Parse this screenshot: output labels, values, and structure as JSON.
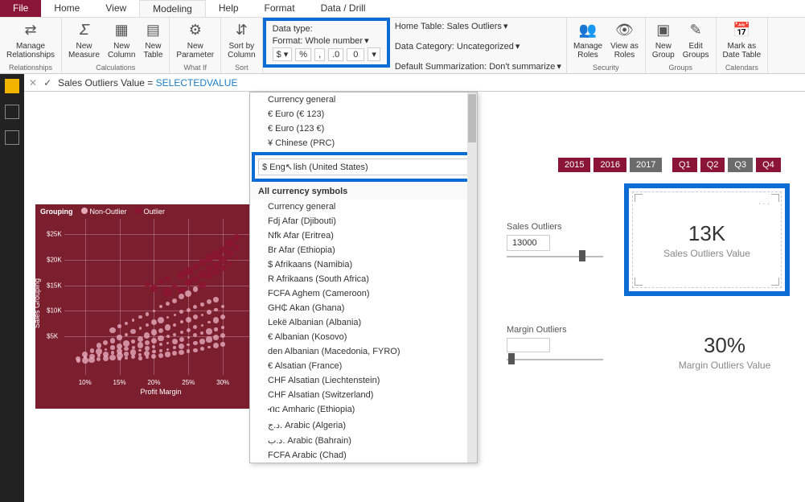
{
  "tabs": {
    "file": "File",
    "home": "Home",
    "view": "View",
    "modeling": "Modeling",
    "help": "Help",
    "format": "Format",
    "data_drill": "Data / Drill"
  },
  "ribbon": {
    "relationships": {
      "item": "Manage\nRelationships",
      "label": "Relationships"
    },
    "calculations": {
      "new_measure": "New\nMeasure",
      "new_column": "New\nColumn",
      "new_table": "New\nTable",
      "new_parameter": "New\nParameter",
      "label": "Calculations"
    },
    "whatif": {
      "label": "What If"
    },
    "sort": {
      "sort_by_column": "Sort by\nColumn",
      "label": "Sort"
    },
    "formatting": {
      "data_type_label": "Data type:",
      "format_label": "Format: Whole number",
      "dollar": "$",
      "pct": "%",
      "comma": ",",
      "dec_label": "0",
      "dec_value": "0"
    },
    "properties": {
      "home_table": "Home Table: Sales Outliers",
      "caret": "▾",
      "data_category": "Data Category: Uncategorized",
      "caret2": "▾",
      "default_summ": "Default Summarization: Don't summarize",
      "caret3": "▾"
    },
    "security": {
      "manage_roles": "Manage\nRoles",
      "view_as": "View as\nRoles",
      "label": "Security"
    },
    "groups": {
      "new_group": "New\nGroup",
      "edit_groups": "Edit\nGroups",
      "label": "Groups"
    },
    "calendars": {
      "mark_date": "Mark as\nDate Table",
      "label": "Calendars"
    }
  },
  "formula": {
    "x": "✕",
    "check": "✓",
    "text_pre": "Sales Outliers Value = ",
    "fn": "SELECTEDVALUE"
  },
  "chart_data": {
    "type": "scatter",
    "title": "",
    "xlabel": "Profit Margin",
    "ylabel": "Sales Grouping",
    "legend": {
      "grouping": "Grouping",
      "non_outlier": "Non-Outlier",
      "outlier": "Outlier"
    },
    "x_ticks": [
      "10%",
      "15%",
      "20%",
      "25%",
      "30%"
    ],
    "y_ticks": [
      "$5K",
      "$10K",
      "$15K",
      "$20K",
      "$25K"
    ],
    "xlim": [
      7,
      35
    ],
    "ylim": [
      0,
      28000
    ],
    "series": [
      {
        "name": "Non-Outlier",
        "points": [
          [
            9,
            200
          ],
          [
            9,
            600
          ],
          [
            10,
            300
          ],
          [
            10,
            900
          ],
          [
            10,
            1500
          ],
          [
            11,
            400
          ],
          [
            11,
            1100
          ],
          [
            11,
            2200
          ],
          [
            12,
            500
          ],
          [
            12,
            1300
          ],
          [
            12,
            2000
          ],
          [
            12,
            3200
          ],
          [
            13,
            700
          ],
          [
            13,
            1500
          ],
          [
            13,
            2400
          ],
          [
            13,
            3800
          ],
          [
            14,
            900
          ],
          [
            14,
            1800
          ],
          [
            14,
            2800
          ],
          [
            14,
            4200
          ],
          [
            15,
            600
          ],
          [
            15,
            1200
          ],
          [
            15,
            2100
          ],
          [
            15,
            3100
          ],
          [
            15,
            4800
          ],
          [
            16,
            800
          ],
          [
            16,
            1600
          ],
          [
            16,
            2600
          ],
          [
            16,
            3600
          ],
          [
            16,
            5400
          ],
          [
            17,
            1000
          ],
          [
            17,
            1900
          ],
          [
            17,
            2900
          ],
          [
            17,
            4000
          ],
          [
            17,
            6000
          ],
          [
            18,
            700
          ],
          [
            18,
            1400
          ],
          [
            18,
            2300
          ],
          [
            18,
            3300
          ],
          [
            18,
            4500
          ],
          [
            18,
            6600
          ],
          [
            19,
            900
          ],
          [
            19,
            1700
          ],
          [
            19,
            2700
          ],
          [
            19,
            3800
          ],
          [
            19,
            5200
          ],
          [
            19,
            7200
          ],
          [
            20,
            1100
          ],
          [
            20,
            2000
          ],
          [
            20,
            3000
          ],
          [
            20,
            4200
          ],
          [
            20,
            5800
          ],
          [
            20,
            7800
          ],
          [
            21,
            1300
          ],
          [
            21,
            2200
          ],
          [
            21,
            3400
          ],
          [
            21,
            4600
          ],
          [
            21,
            6200
          ],
          [
            21,
            8200
          ],
          [
            22,
            1500
          ],
          [
            22,
            2500
          ],
          [
            22,
            3700
          ],
          [
            22,
            5000
          ],
          [
            22,
            6800
          ],
          [
            22,
            8800
          ],
          [
            23,
            1700
          ],
          [
            23,
            2800
          ],
          [
            23,
            4000
          ],
          [
            23,
            5400
          ],
          [
            23,
            7200
          ],
          [
            23,
            9200
          ],
          [
            24,
            1900
          ],
          [
            24,
            3100
          ],
          [
            24,
            4400
          ],
          [
            24,
            5800
          ],
          [
            24,
            7800
          ],
          [
            24,
            9800
          ],
          [
            25,
            2100
          ],
          [
            25,
            3400
          ],
          [
            25,
            4800
          ],
          [
            25,
            6200
          ],
          [
            25,
            8200
          ],
          [
            25,
            10200
          ],
          [
            26,
            2300
          ],
          [
            26,
            3700
          ],
          [
            26,
            5200
          ],
          [
            26,
            6800
          ],
          [
            26,
            8800
          ],
          [
            26,
            10800
          ],
          [
            27,
            2600
          ],
          [
            27,
            4000
          ],
          [
            27,
            5600
          ],
          [
            27,
            7200
          ],
          [
            27,
            9200
          ],
          [
            27,
            11200
          ],
          [
            28,
            2900
          ],
          [
            28,
            4400
          ],
          [
            28,
            6000
          ],
          [
            28,
            7800
          ],
          [
            28,
            9800
          ],
          [
            28,
            11800
          ],
          [
            29,
            3200
          ],
          [
            29,
            4800
          ],
          [
            29,
            6400
          ],
          [
            29,
            8200
          ],
          [
            29,
            10200
          ],
          [
            29,
            12200
          ],
          [
            30,
            3500
          ],
          [
            30,
            5200
          ],
          [
            30,
            6800
          ],
          [
            30,
            8800
          ],
          [
            30,
            10800
          ],
          [
            14,
            6200
          ],
          [
            15,
            7000
          ],
          [
            16,
            7600
          ],
          [
            17,
            8200
          ],
          [
            18,
            8800
          ],
          [
            19,
            9400
          ],
          [
            20,
            10000
          ],
          [
            21,
            10800
          ],
          [
            22,
            11400
          ],
          [
            23,
            12000
          ],
          [
            24,
            12800
          ],
          [
            25,
            13400
          ],
          [
            26,
            14200
          ]
        ]
      },
      {
        "name": "Outlier",
        "points": [
          [
            19,
            15200
          ],
          [
            20,
            14400
          ],
          [
            21,
            15800
          ],
          [
            22,
            13600
          ],
          [
            22,
            16400
          ],
          [
            23,
            14800
          ],
          [
            24,
            17000
          ],
          [
            24,
            14000
          ],
          [
            25,
            15600
          ],
          [
            25,
            17800
          ],
          [
            26,
            16200
          ],
          [
            26,
            18600
          ],
          [
            27,
            15000
          ],
          [
            27,
            17200
          ],
          [
            27,
            19400
          ],
          [
            28,
            16800
          ],
          [
            28,
            18200
          ],
          [
            28,
            20200
          ],
          [
            29,
            17600
          ],
          [
            29,
            19000
          ],
          [
            29,
            21000
          ],
          [
            30,
            18400
          ],
          [
            30,
            20000
          ],
          [
            30,
            22000
          ],
          [
            31,
            19200
          ],
          [
            31,
            21200
          ],
          [
            31,
            23200
          ],
          [
            32,
            20400
          ],
          [
            32,
            22400
          ],
          [
            32,
            24400
          ]
        ]
      }
    ]
  },
  "dropdown": {
    "top": [
      "Currency general",
      "€ Euro (€ 123)",
      "€ Euro (123 €)",
      "¥ Chinese (PRC)"
    ],
    "search_value": "$ English (United States)",
    "header": "All currency symbols",
    "items": [
      "Currency general",
      "Fdj Afar (Djibouti)",
      "Nfk Afar (Eritrea)",
      "Br Afar (Ethiopia)",
      "$ Afrikaans (Namibia)",
      "R Afrikaans (South Africa)",
      "FCFA Aghem (Cameroon)",
      "GH₵ Akan (Ghana)",
      "Lekë Albanian (Albania)",
      "€ Albanian (Kosovo)",
      "den Albanian (Macedonia, FYRO)",
      "€ Alsatian (France)",
      "CHF Alsatian (Liechtenstein)",
      "CHF Alsatian (Switzerland)",
      "ብር Amharic (Ethiopia)",
      "د.ج. Arabic (Algeria)",
      "د.ب. Arabic (Bahrain)",
      "FCFA Arabic (Chad)"
    ]
  },
  "filters": {
    "years": [
      "2015",
      "2016",
      "2017"
    ],
    "year_grey_idx": 2,
    "quarters": [
      "Q1",
      "Q2",
      "Q3",
      "Q4"
    ],
    "q_grey_idx": 2
  },
  "cards": {
    "sales": {
      "value": "13K",
      "label": "Sales Outliers Value",
      "dots": "..."
    },
    "margin": {
      "value": "30%",
      "label": "Margin Outliers Value"
    }
  },
  "slicers": {
    "sales": {
      "label": "Sales Outliers",
      "value": "13000"
    },
    "margin": {
      "label": "Margin Outliers"
    }
  }
}
